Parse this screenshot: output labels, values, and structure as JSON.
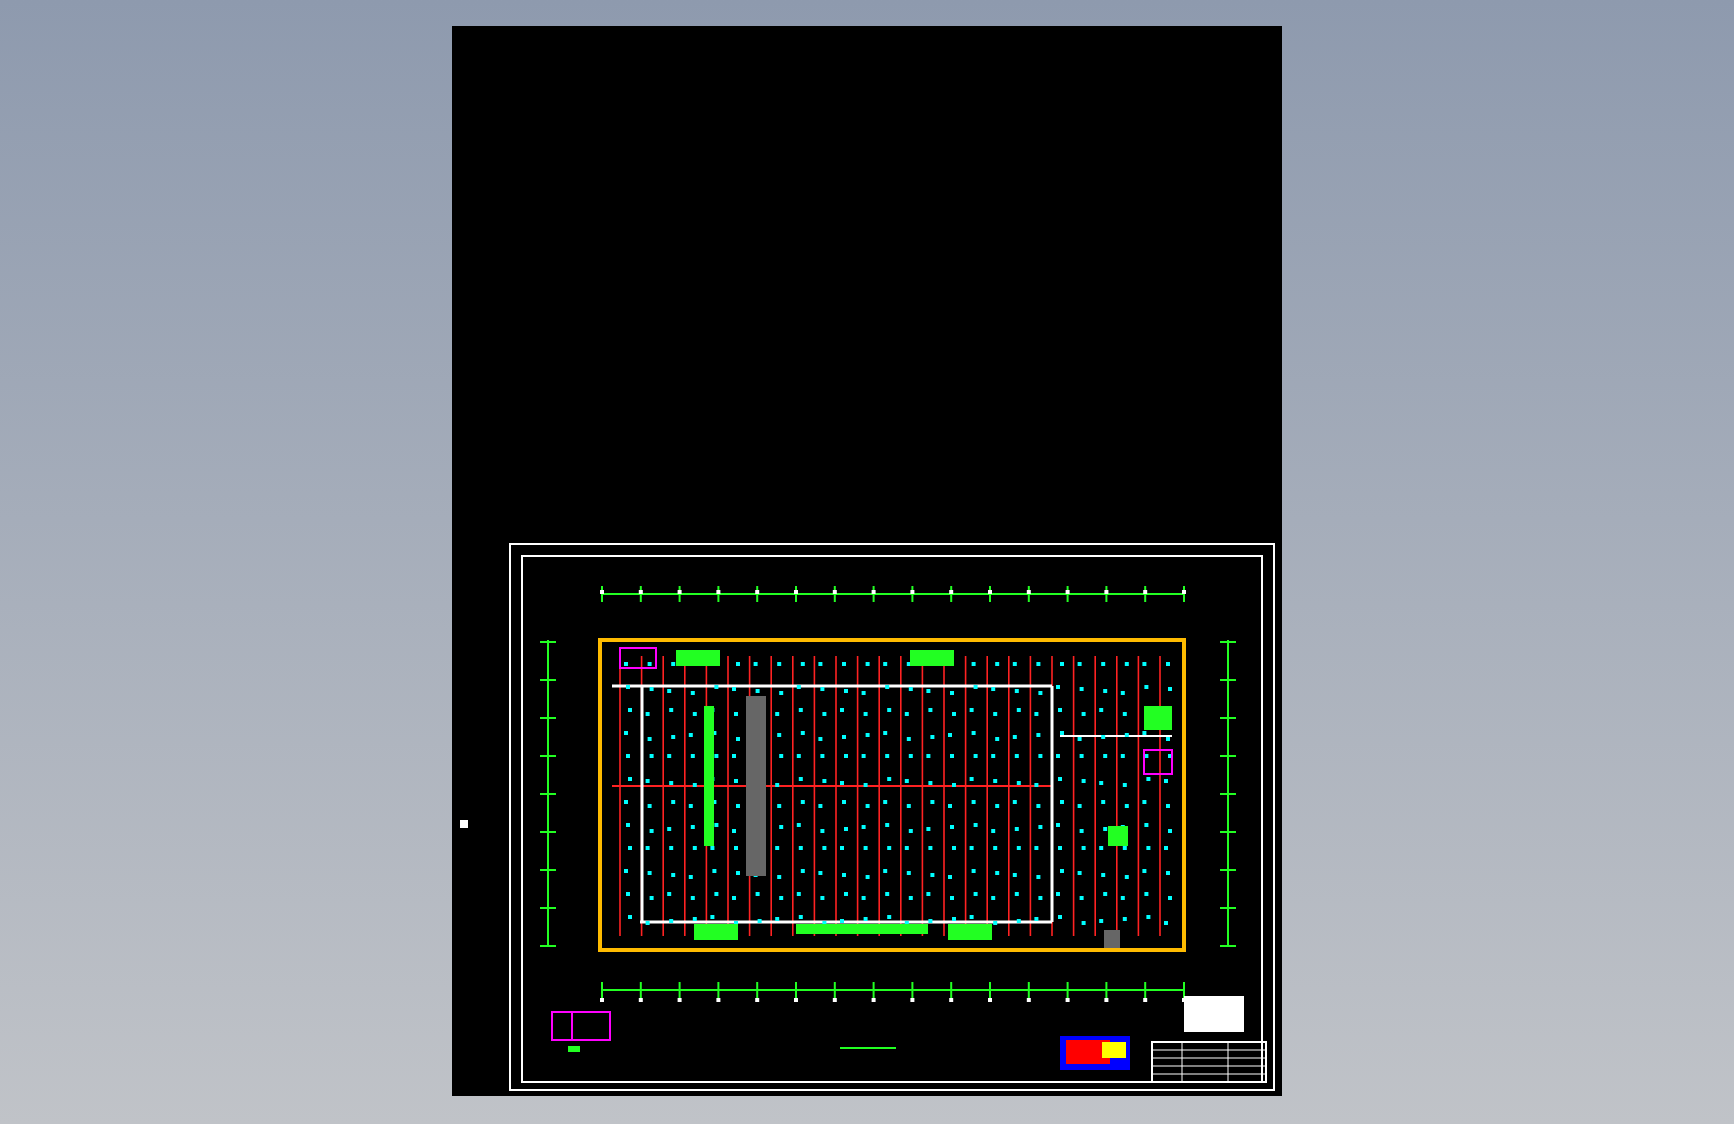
{
  "sheet": {
    "kind": "floor-plan"
  }
}
